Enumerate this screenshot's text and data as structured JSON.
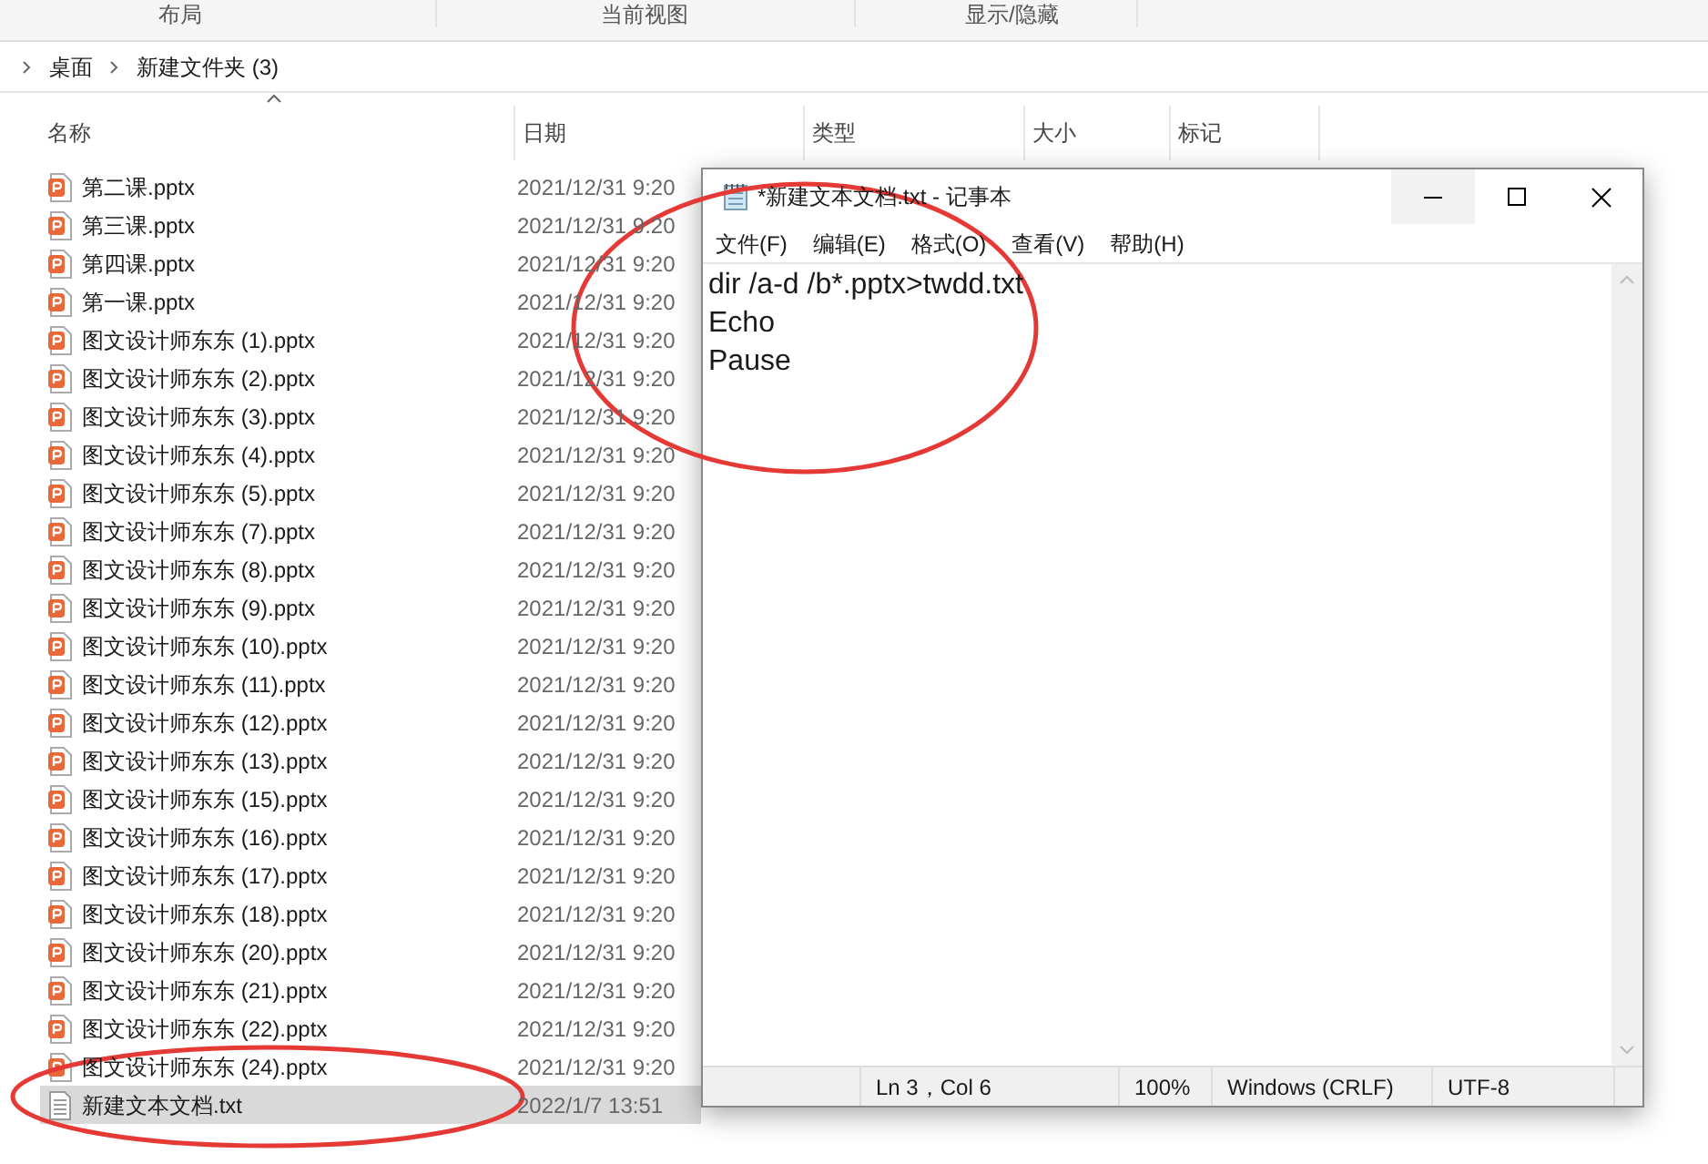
{
  "ribbon": {
    "groups": [
      "布局",
      "当前视图",
      "显示/隐藏"
    ]
  },
  "breadcrumb": [
    "桌面",
    "新建文件夹 (3)"
  ],
  "columns": [
    "名称",
    "日期",
    "类型",
    "大小",
    "标记"
  ],
  "files": [
    {
      "name": "第二课.pptx",
      "date": "2021/12/31 9:20",
      "kind": "pptx",
      "selected": false
    },
    {
      "name": "第三课.pptx",
      "date": "2021/12/31 9:20",
      "kind": "pptx",
      "selected": false
    },
    {
      "name": "第四课.pptx",
      "date": "2021/12/31 9:20",
      "kind": "pptx",
      "selected": false
    },
    {
      "name": "第一课.pptx",
      "date": "2021/12/31 9:20",
      "kind": "pptx",
      "selected": false
    },
    {
      "name": "图文设计师东东 (1).pptx",
      "date": "2021/12/31 9:20",
      "kind": "pptx",
      "selected": false
    },
    {
      "name": "图文设计师东东 (2).pptx",
      "date": "2021/12/31 9:20",
      "kind": "pptx",
      "selected": false
    },
    {
      "name": "图文设计师东东 (3).pptx",
      "date": "2021/12/31 9:20",
      "kind": "pptx",
      "selected": false
    },
    {
      "name": "图文设计师东东 (4).pptx",
      "date": "2021/12/31 9:20",
      "kind": "pptx",
      "selected": false
    },
    {
      "name": "图文设计师东东 (5).pptx",
      "date": "2021/12/31 9:20",
      "kind": "pptx",
      "selected": false
    },
    {
      "name": "图文设计师东东 (7).pptx",
      "date": "2021/12/31 9:20",
      "kind": "pptx",
      "selected": false
    },
    {
      "name": "图文设计师东东 (8).pptx",
      "date": "2021/12/31 9:20",
      "kind": "pptx",
      "selected": false
    },
    {
      "name": "图文设计师东东 (9).pptx",
      "date": "2021/12/31 9:20",
      "kind": "pptx",
      "selected": false
    },
    {
      "name": "图文设计师东东 (10).pptx",
      "date": "2021/12/31 9:20",
      "kind": "pptx",
      "selected": false
    },
    {
      "name": "图文设计师东东 (11).pptx",
      "date": "2021/12/31 9:20",
      "kind": "pptx",
      "selected": false
    },
    {
      "name": "图文设计师东东 (12).pptx",
      "date": "2021/12/31 9:20",
      "kind": "pptx",
      "selected": false
    },
    {
      "name": "图文设计师东东 (13).pptx",
      "date": "2021/12/31 9:20",
      "kind": "pptx",
      "selected": false
    },
    {
      "name": "图文设计师东东 (15).pptx",
      "date": "2021/12/31 9:20",
      "kind": "pptx",
      "selected": false
    },
    {
      "name": "图文设计师东东 (16).pptx",
      "date": "2021/12/31 9:20",
      "kind": "pptx",
      "selected": false
    },
    {
      "name": "图文设计师东东 (17).pptx",
      "date": "2021/12/31 9:20",
      "kind": "pptx",
      "selected": false
    },
    {
      "name": "图文设计师东东 (18).pptx",
      "date": "2021/12/31 9:20",
      "kind": "pptx",
      "selected": false
    },
    {
      "name": "图文设计师东东 (20).pptx",
      "date": "2021/12/31 9:20",
      "kind": "pptx",
      "selected": false
    },
    {
      "name": "图文设计师东东 (21).pptx",
      "date": "2021/12/31 9:20",
      "kind": "pptx",
      "selected": false
    },
    {
      "name": "图文设计师东东 (22).pptx",
      "date": "2021/12/31 9:20",
      "kind": "pptx",
      "selected": false
    },
    {
      "name": "图文设计师东东 (24).pptx",
      "date": "2021/12/31 9:20",
      "kind": "pptx",
      "selected": false
    },
    {
      "name": "新建文本文档.txt",
      "date": "2022/1/7 13:51",
      "kind": "txt",
      "selected": true
    }
  ],
  "notepad": {
    "title": "*新建文本文档.txt - 记事本",
    "menu": [
      "文件(F)",
      "编辑(E)",
      "格式(O)",
      "查看(V)",
      "帮助(H)"
    ],
    "lines": [
      "dir /a-d /b*.pptx>twdd.txt",
      "Echo",
      "Pause"
    ],
    "status": [
      "Ln 3，Col 6",
      "100%",
      "Windows (CRLF)",
      "UTF-8"
    ]
  }
}
